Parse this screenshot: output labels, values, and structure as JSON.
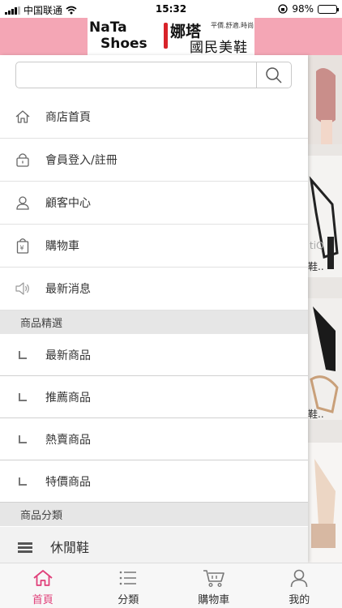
{
  "status_bar": {
    "carrier": "中国联通",
    "time": "15:32",
    "battery": "98%",
    "battery_level": 0.98
  },
  "header": {
    "logo_en_line1": "NaTa",
    "logo_en_line2": "Shoes",
    "logo_cn_line1": "娜塔",
    "logo_slogan": "平價.舒適.時尚",
    "logo_cn_line2": "國民美鞋",
    "bg_color": "#f4a6b5"
  },
  "search": {
    "value": "",
    "placeholder": ""
  },
  "menu": {
    "items": [
      {
        "label": "商店首頁",
        "icon": "home-icon"
      },
      {
        "label": "會員登入/註冊",
        "icon": "lock-icon"
      },
      {
        "label": "顧客中心",
        "icon": "user-icon"
      },
      {
        "label": "購物車",
        "icon": "shopping-bag-icon"
      },
      {
        "label": "最新消息",
        "icon": "speaker-icon"
      }
    ]
  },
  "featured": {
    "title": "商品精選",
    "items": [
      {
        "label": "最新商品"
      },
      {
        "label": "推薦商品"
      },
      {
        "label": "熱賣商品"
      },
      {
        "label": "特價商品"
      }
    ]
  },
  "categories": {
    "title": "商品分類",
    "items": [
      {
        "label": "休閒鞋"
      }
    ]
  },
  "background_products": {
    "text1": "鞋..",
    "text2": "鞋.."
  },
  "tabbar": {
    "active_color": "#e0407a",
    "tabs": [
      {
        "label": "首頁",
        "icon": "home-icon"
      },
      {
        "label": "分類",
        "icon": "list-icon"
      },
      {
        "label": "購物車",
        "icon": "cart-icon"
      },
      {
        "label": "我的",
        "icon": "user-icon"
      }
    ]
  }
}
